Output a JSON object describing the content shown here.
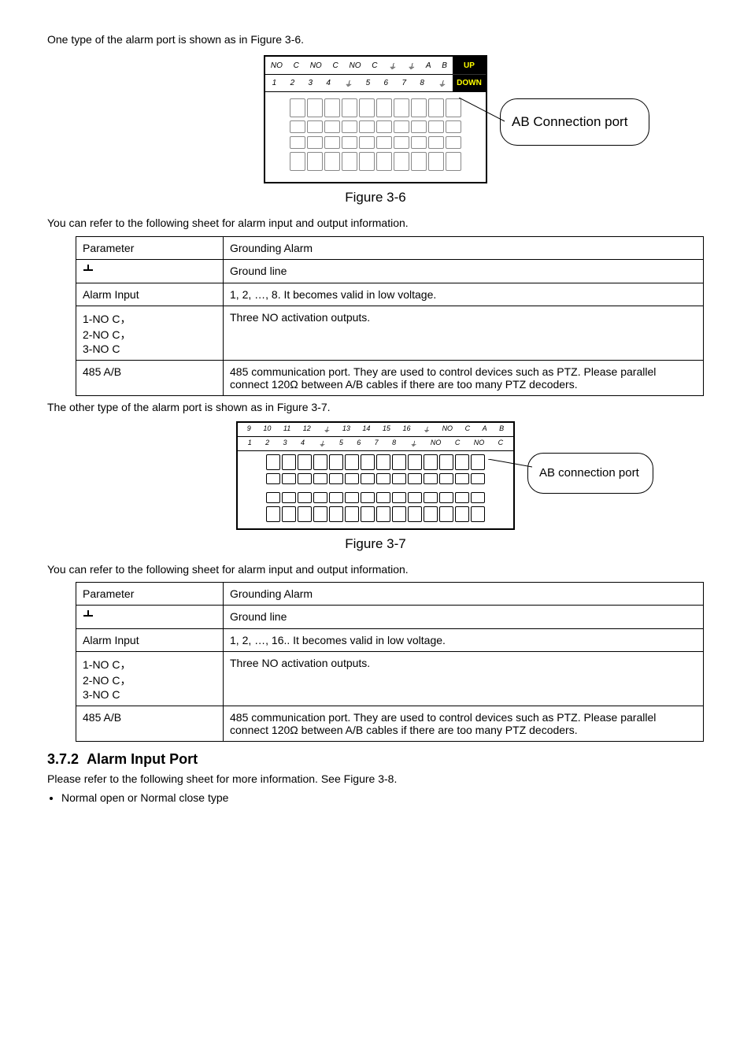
{
  "intro36": "One type of the alarm port is shown as in Figure 3-6.",
  "fig36": {
    "header_row1": [
      "NO",
      "C",
      "NO",
      "C",
      "NO",
      "C",
      "⏚",
      "⏚",
      "A",
      "B"
    ],
    "header_row2": [
      "1",
      "2",
      "3",
      "4",
      "⏚",
      "5",
      "6",
      "7",
      "8",
      "⏚"
    ],
    "up_label": "UP",
    "down_label": "DOWN",
    "callout": "AB Connection port",
    "caption": "Figure 3-6"
  },
  "lead_text": "You can refer to the following sheet for alarm input and output information.",
  "table1": {
    "rows": [
      {
        "c1": "Parameter",
        "c2": "Grounding Alarm"
      },
      {
        "c1_icon": true,
        "c2": "Ground line"
      },
      {
        "c1": "Alarm Input",
        "c2": "1, 2, …, 8. It becomes valid in low voltage."
      },
      {
        "c1": "1-NO C，\n2-NO C，\n3-NO C",
        "c2": "Three NO activation outputs."
      },
      {
        "c1": "485 A/B",
        "c2": "485 communication port. They are used to control devices such as PTZ. Please parallel connect 120Ω between A/B cables if there are too many PTZ decoders."
      }
    ]
  },
  "intro37": "The other type of the alarm port is shown as in Figure 3-7.",
  "fig37": {
    "row1": [
      "9",
      "10",
      "11",
      "12",
      "⏚",
      "13",
      "14",
      "15",
      "16",
      "⏚",
      "NO",
      "C",
      "A",
      "B"
    ],
    "row2": [
      "1",
      "2",
      "3",
      "4",
      "⏚",
      "5",
      "6",
      "7",
      "8",
      "⏚",
      "NO",
      "C",
      "NO",
      "C"
    ],
    "callout": "AB connection port",
    "caption": "Figure 3-7"
  },
  "table2": {
    "rows": [
      {
        "c1": "Parameter",
        "c2": "Grounding Alarm"
      },
      {
        "c1_icon": true,
        "c2": "Ground line"
      },
      {
        "c1": "Alarm Input",
        "c2": "1, 2, …, 16.. It becomes valid in low voltage."
      },
      {
        "c1": "1-NO C，\n2-NO C，\n3-NO C",
        "c2": "Three NO activation outputs."
      },
      {
        "c1": "485 A/B",
        "c2": "485 communication port. They are used to control devices such as PTZ. Please parallel connect 120Ω between A/B cables if there are too many PTZ decoders."
      }
    ]
  },
  "section": {
    "num": "3.7.2",
    "title": "Alarm Input Port",
    "desc": "Please refer to the following sheet for more information. See Figure 3-8.",
    "bullet": "Normal open or Normal close type"
  }
}
